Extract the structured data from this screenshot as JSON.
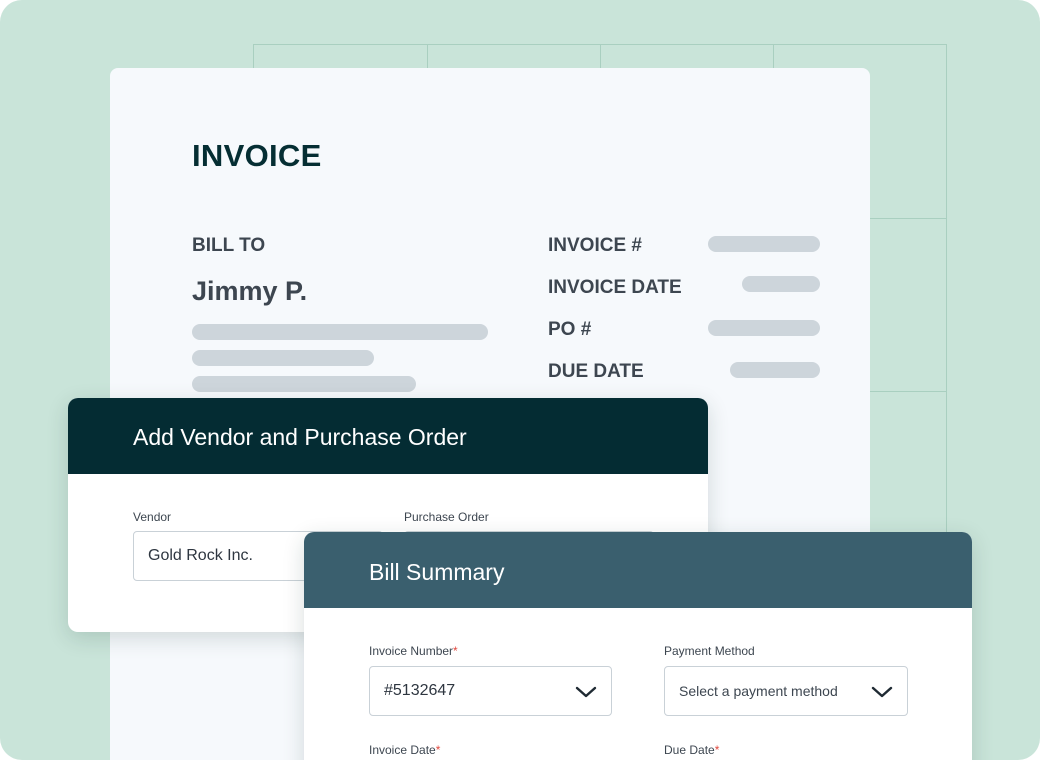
{
  "invoice": {
    "title": "INVOICE",
    "bill_to_label": "BILL TO",
    "customer_name": "Jimmy P.",
    "meta_labels": [
      "INVOICE #",
      "INVOICE DATE",
      "PO #",
      "DUE DATE"
    ]
  },
  "vendor_dialog": {
    "title": "Add Vendor and Purchase Order",
    "vendor_label": "Vendor",
    "vendor_value": "Gold Rock Inc.",
    "purchase_order_label": "Purchase Order"
  },
  "bill_summary": {
    "title": "Bill Summary",
    "invoice_number_label": "Invoice Number",
    "invoice_number_value": "#5132647",
    "payment_method_label": "Payment Method",
    "payment_method_placeholder": "Select a payment method",
    "invoice_date_label": "Invoice Date",
    "due_date_label": "Due Date",
    "required_marker": "*"
  },
  "colors": {
    "background": "#c9e4d9",
    "vendor_header": "#042c33",
    "summary_header": "#3a5f6e",
    "required": "#e0483e"
  }
}
